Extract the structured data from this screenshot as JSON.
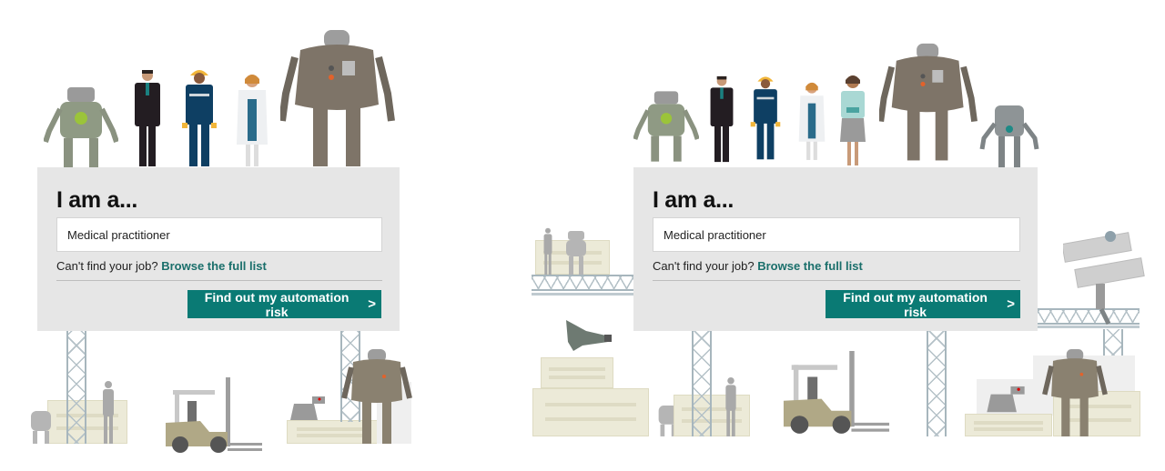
{
  "colors": {
    "accent": "#0a7a74",
    "link": "#1a6f6b",
    "panel_bg": "#e6e6e6"
  },
  "panels": [
    {
      "heading": "I am a...",
      "job_input_value": "Medical practitioner",
      "help_text": "Can't find your job?",
      "browse_link": "Browse the full list",
      "submit_label": "Find out my automation risk",
      "submit_icon": "chevron-right-icon"
    },
    {
      "heading": "I am a...",
      "job_input_value": "Medical practitioner",
      "help_text": "Can't find your job?",
      "browse_link": "Browse the full list",
      "submit_label": "Find out my automation risk",
      "submit_icon": "chevron-right-icon"
    }
  ],
  "illustrations": {
    "top_row_left": [
      "green-robot",
      "businessman",
      "construction-worker",
      "doctor",
      "large-brown-robot"
    ],
    "top_row_right": [
      "green-robot",
      "businessman",
      "construction-worker",
      "doctor",
      "office-worker",
      "large-brown-robot",
      "small-teal-robot"
    ],
    "bottom": [
      "scaffold-tower",
      "crates",
      "forklift",
      "robot-dog",
      "robot",
      "person-silhouette",
      "drone",
      "robot-carrying-panels"
    ]
  }
}
